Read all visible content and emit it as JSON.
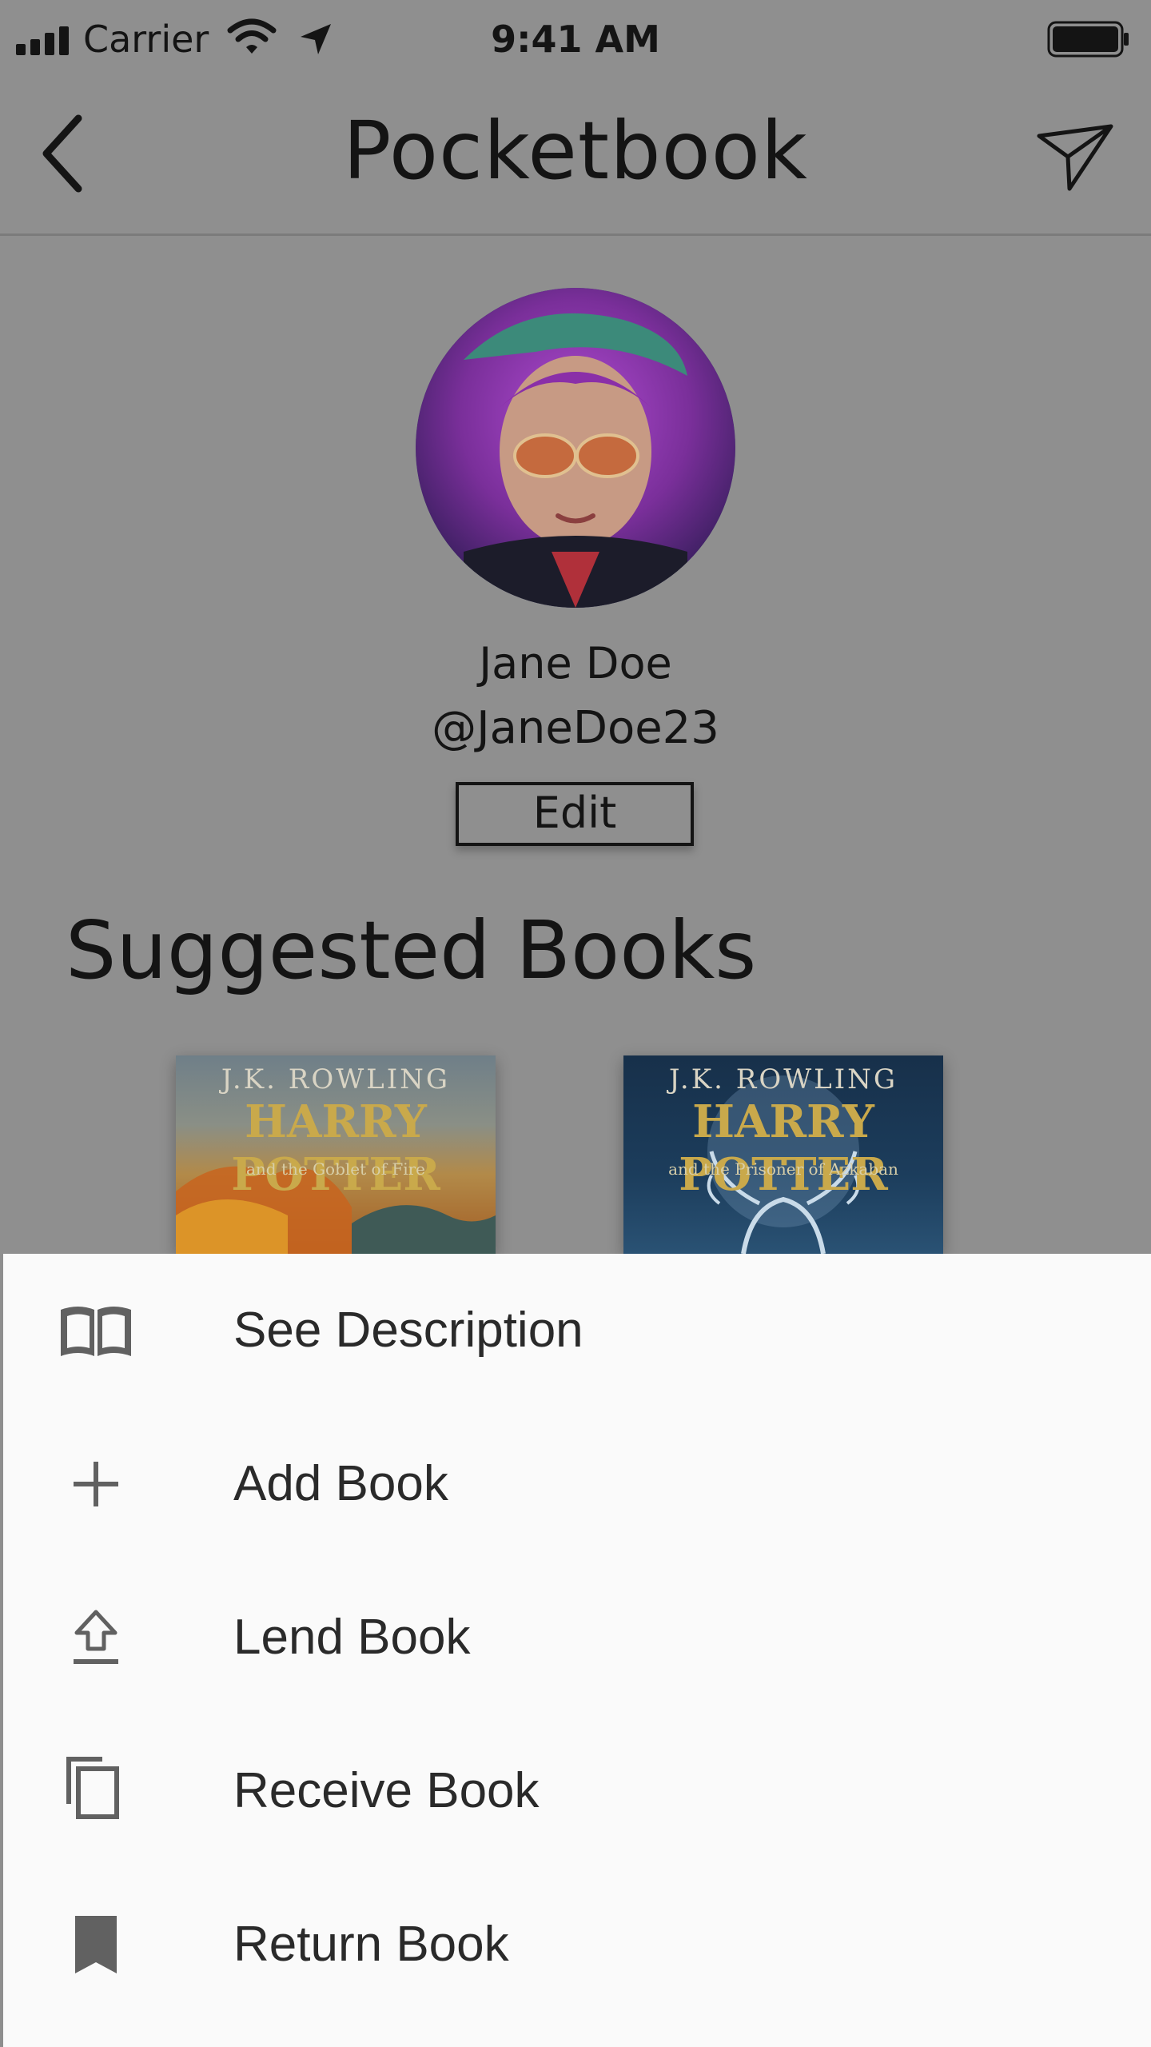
{
  "status_bar": {
    "carrier": "Carrier",
    "time": "9:41 AM"
  },
  "nav": {
    "title": "Pocketbook"
  },
  "profile": {
    "name": "Jane Doe",
    "handle": "@JaneDoe23",
    "edit_label": "Edit"
  },
  "suggested": {
    "title": "Suggested Books",
    "books": [
      {
        "author": "J.K. ROWLING",
        "title": "HARRY POTTER",
        "subtitle": "and the Goblet of Fire"
      },
      {
        "author": "J.K. ROWLING",
        "title": "HARRY POTTER",
        "subtitle": "and the Prisoner of Azkaban"
      }
    ]
  },
  "action_sheet": {
    "items": [
      {
        "label": "See Description",
        "icon": "book-open-icon"
      },
      {
        "label": "Add Book",
        "icon": "plus-icon"
      },
      {
        "label": "Lend Book",
        "icon": "upload-icon"
      },
      {
        "label": "Receive Book",
        "icon": "copy-icon"
      },
      {
        "label": "Return Book",
        "icon": "bookmark-icon"
      }
    ]
  },
  "colors": {
    "dim_overlay": "#8f8f8f",
    "sheet_background": "#fafafa",
    "text_dark": "#141414"
  }
}
